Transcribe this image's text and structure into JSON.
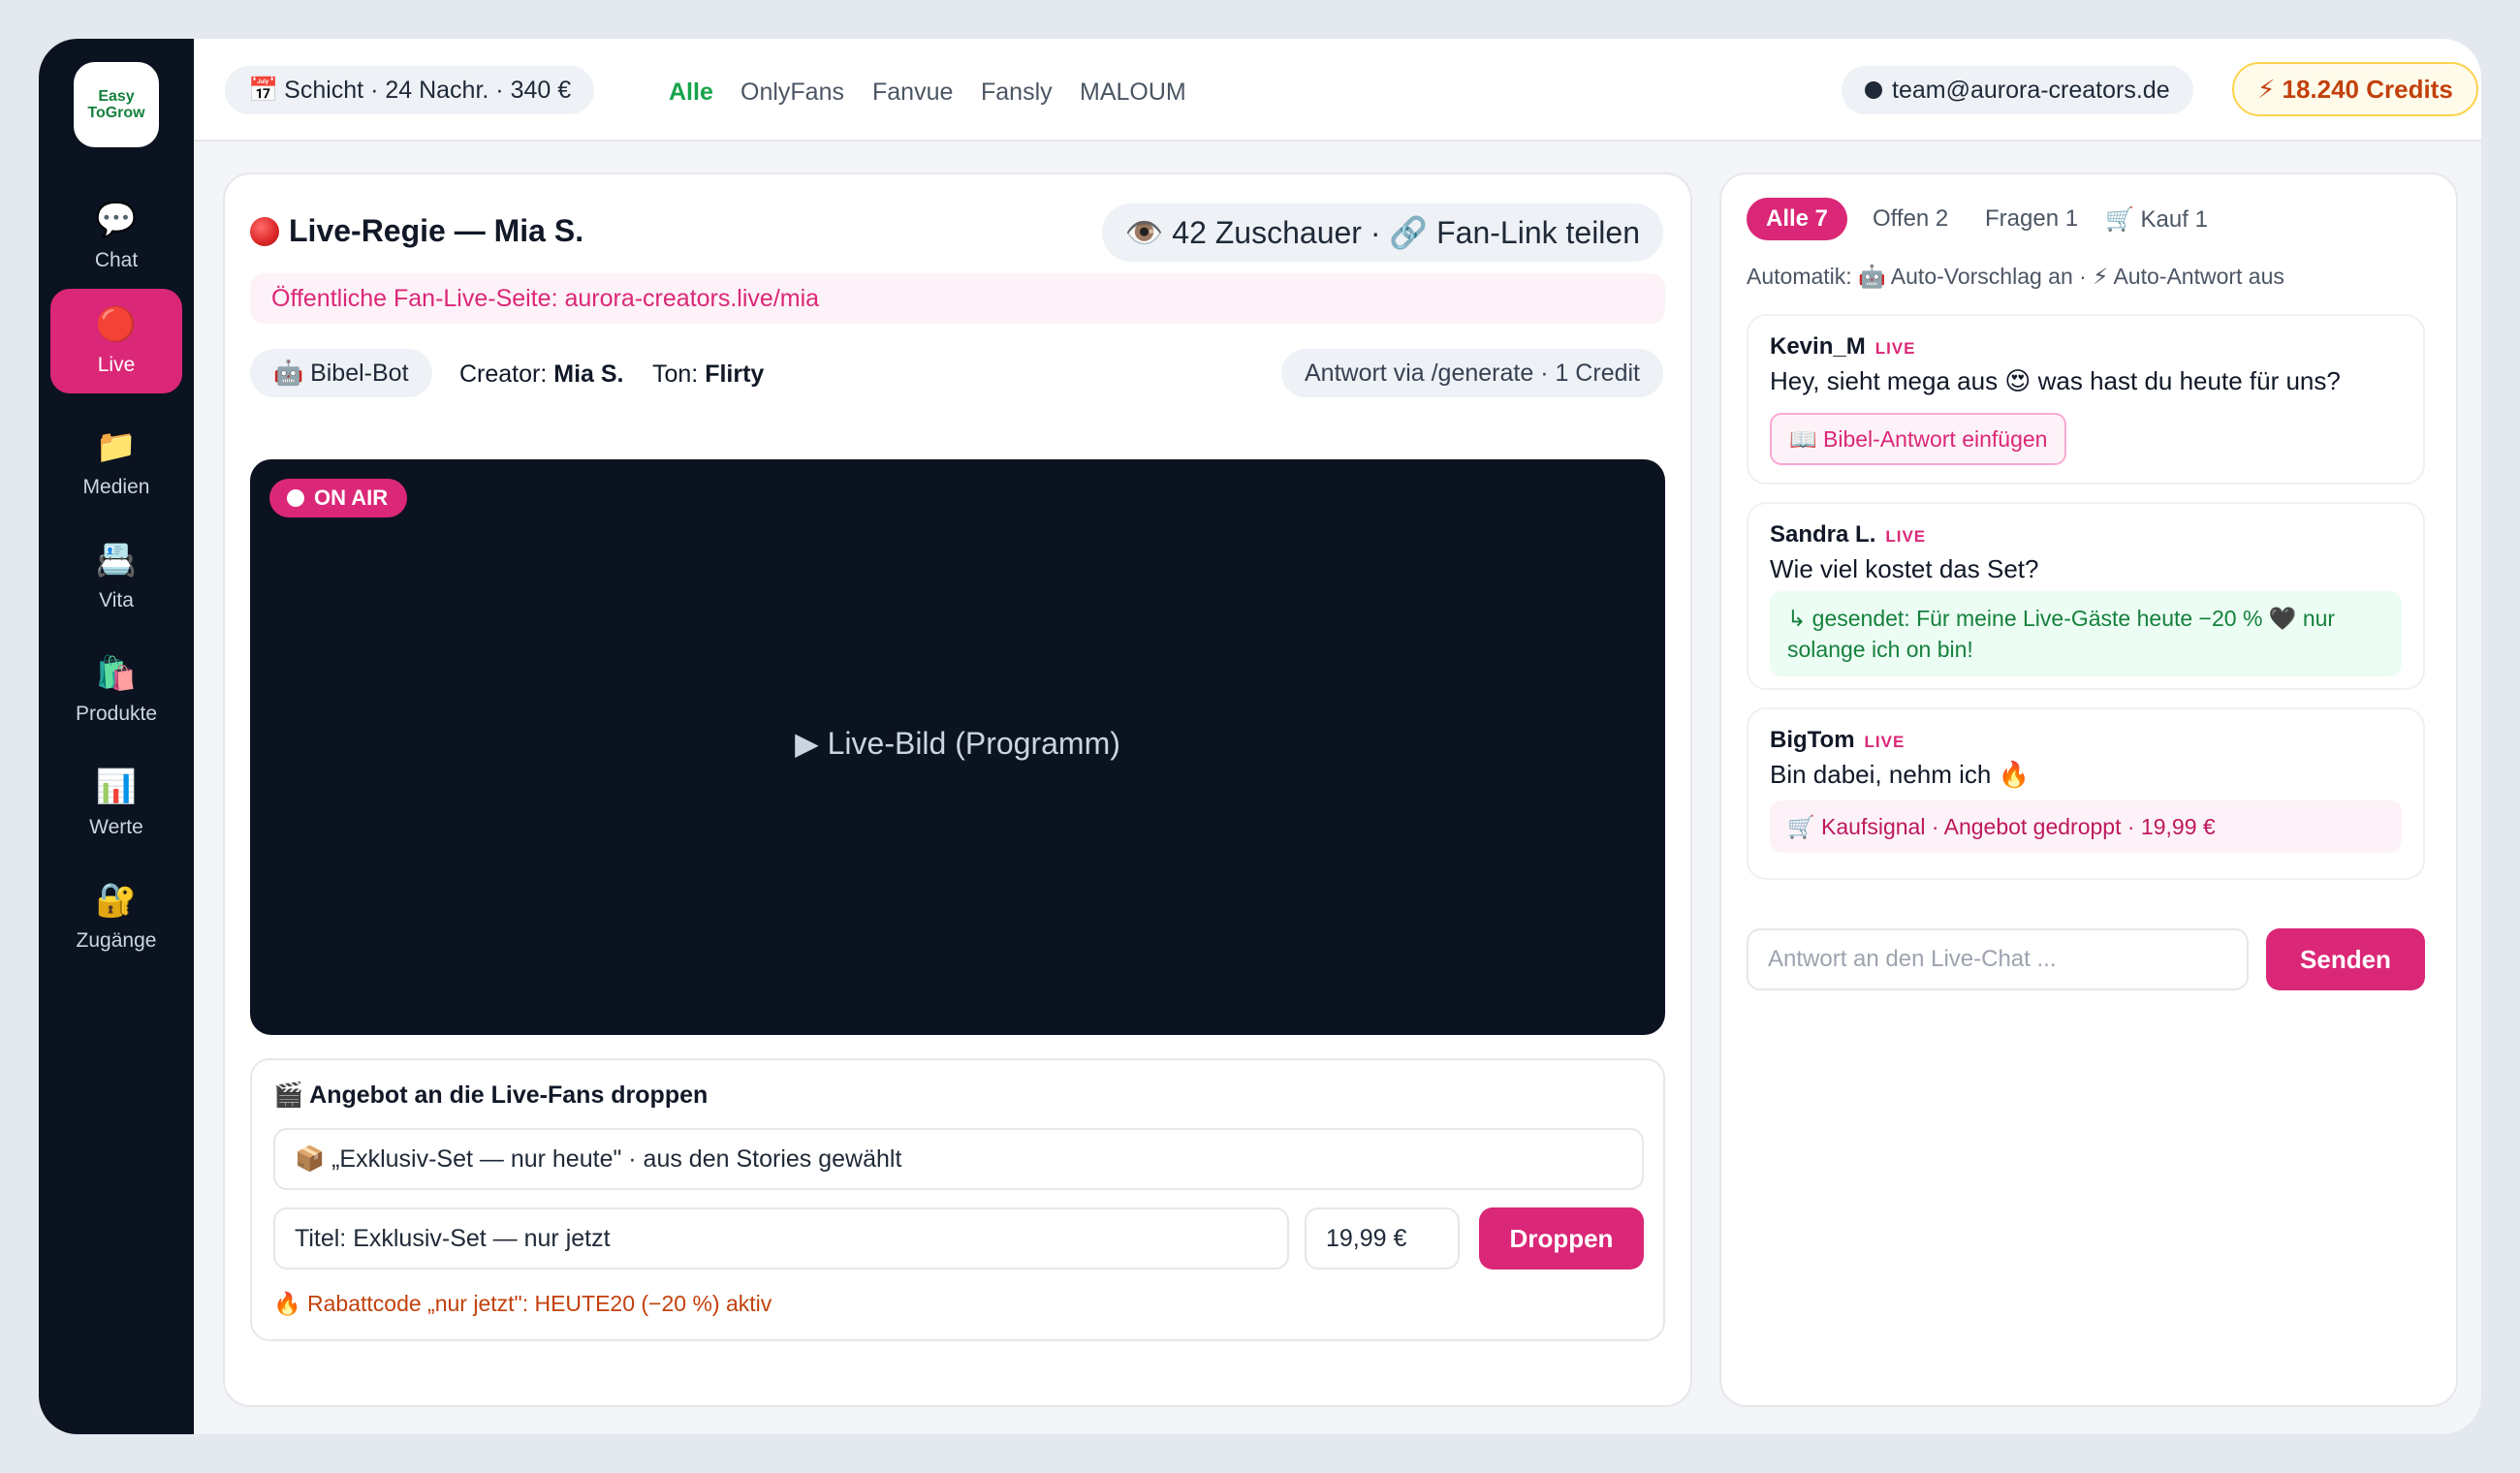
{
  "sidebar": {
    "logo_line1": "Easy",
    "logo_line2": "ToGrow",
    "items": [
      {
        "icon": "💬",
        "label": "Chat",
        "active": false
      },
      {
        "icon": "🔴",
        "label": "Live",
        "active": true
      },
      {
        "icon": "📁",
        "label": "Medien",
        "active": false
      },
      {
        "icon": "📇",
        "label": "Vita",
        "active": false
      },
      {
        "icon": "🛍️",
        "label": "Produkte",
        "active": false
      },
      {
        "icon": "📊",
        "label": "Werte",
        "active": false
      },
      {
        "icon": "🔐",
        "label": "Zugänge",
        "active": false
      }
    ]
  },
  "topbar": {
    "shift_icon": "📅",
    "shift": "Schicht · 24 Nachr. · 340 €",
    "platforms": [
      "Alle",
      "OnlyFans",
      "Fanvue",
      "Fansly",
      "MALOUM"
    ],
    "active_platform": "Alle",
    "email": "team@aurora-creators.de",
    "credits": "⚡ 18.240 Credits"
  },
  "live": {
    "title": "Live-Regie — Mia S.",
    "viewers": "👁️ 42 Zuschauer · 🔗 Fan-Link teilen",
    "public_page": "Öffentliche Fan-Live-Seite: aurora-creators.live/mia",
    "bot": "🤖 Bibel-Bot",
    "creator_label": "Creator:",
    "creator_value": "Mia S.",
    "tone_label": "Ton:",
    "tone_value": "Flirty",
    "api": "Antwort via /generate · 1 Credit",
    "on_air": "ON AIR",
    "video_label": "▶ Live-Bild (Programm)"
  },
  "offer": {
    "title": "🎬 Angebot an die Live-Fans droppen",
    "selection": "📦 „Exklusiv-Set — nur heute\" · aus den Stories gewählt",
    "title_field": "Titel: Exklusiv-Set — nur jetzt",
    "price": "19,99 €",
    "drop_button": "Droppen",
    "discount": "🔥 Rabattcode „nur jetzt\": HEUTE20 (−20 %) aktiv"
  },
  "chat": {
    "filters": [
      "Alle 7",
      "Offen 2",
      "Fragen 1",
      "🛒 Kauf 1"
    ],
    "automatik": "Automatik: 🤖 Auto-Vorschlag an · ⚡ Auto-Antwort aus",
    "live_tag": "LIVE",
    "messages": [
      {
        "name": "Kevin_M",
        "text": "Hey, sieht mega aus 😍 was hast du heute für uns?",
        "action": "📖 Bibel-Antwort einfügen"
      },
      {
        "name": "Sandra L.",
        "text": "Wie viel kostet das Set?",
        "reply": "↳ gesendet: Für meine Live-Gäste heute −20 % 🖤 nur solange ich on bin!"
      },
      {
        "name": "BigTom",
        "text": "Bin dabei, nehm ich 🔥",
        "signal": "🛒 Kaufsignal · Angebot gedroppt · 19,99 €"
      }
    ],
    "input_placeholder": "Antwort an den Live-Chat ...",
    "send_button": "Senden"
  },
  "colors": {
    "accent": "#db2777",
    "sidebar_bg": "#0b1220",
    "success": "#16a34a",
    "warning": "#c2410c"
  }
}
